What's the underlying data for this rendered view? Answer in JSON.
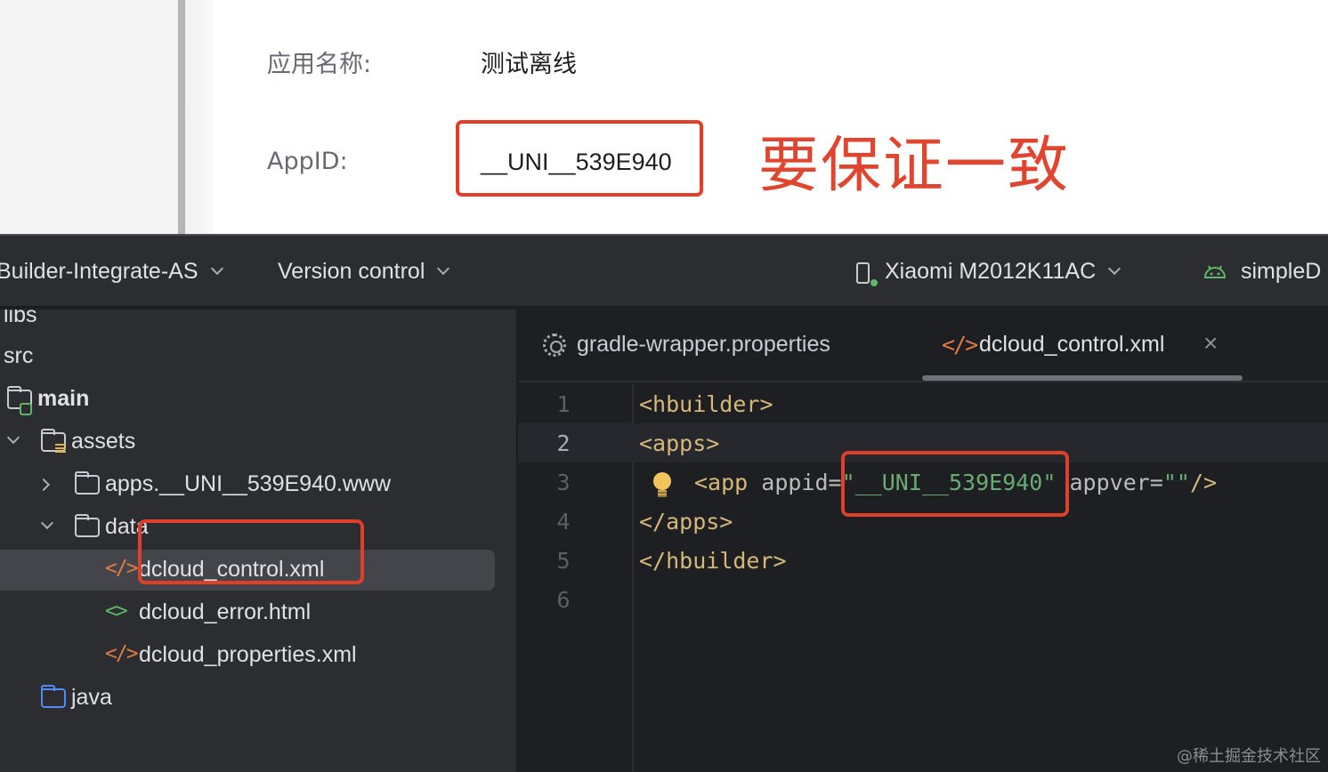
{
  "web": {
    "app_name_label": "应用名称:",
    "app_name_value": "测试离线",
    "appid_label": "AppID:",
    "appid_value": "__UNI__539E940",
    "annotation": "要保证一致"
  },
  "toolbar": {
    "project": "Builder-Integrate-AS",
    "vcs": "Version control",
    "device": "Xiaomi M2012K11AC",
    "run_config": "simpleD"
  },
  "tree": {
    "items": [
      {
        "label": "libs"
      },
      {
        "label": "src"
      },
      {
        "label": "main"
      },
      {
        "label": "assets"
      },
      {
        "label": "apps.__UNI__539E940.www"
      },
      {
        "label": "data"
      },
      {
        "label": "dcloud_control.xml"
      },
      {
        "label": "dcloud_error.html"
      },
      {
        "label": "dcloud_properties.xml"
      },
      {
        "label": "java"
      }
    ]
  },
  "editor": {
    "tabs": [
      {
        "label": "gradle-wrapper.properties"
      },
      {
        "label": "dcloud_control.xml"
      }
    ],
    "active_tab": "dcloud_control.xml",
    "line_numbers": [
      "1",
      "2",
      "3",
      "4",
      "5",
      "6"
    ],
    "lines": {
      "l1": "<hbuilder>",
      "l2": "<apps>",
      "l3_tag": "<app",
      "l3_attr1": "appid=",
      "l3_val1": "\"__UNI__539E940\"",
      "l3_attr2": "appver=",
      "l3_val2": "\"\"",
      "l3_close": "/>",
      "l4": "</apps>",
      "l5": "</hbuilder>"
    }
  },
  "watermark": "@稀土掘金技术社区",
  "colors": {
    "callout": "#e0402a",
    "tag": "#d5b778",
    "string": "#6aab73"
  }
}
